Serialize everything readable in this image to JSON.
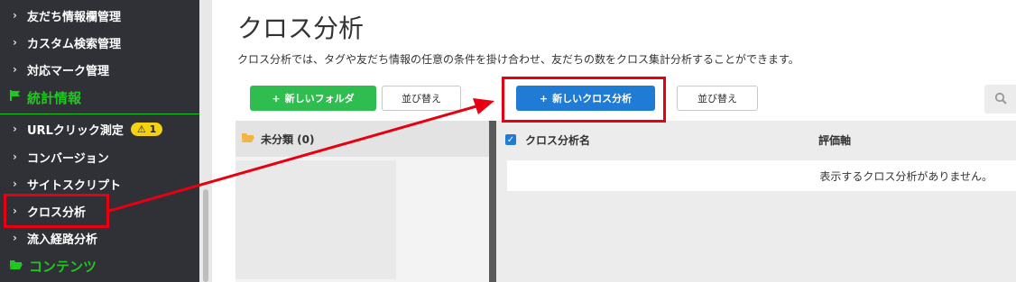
{
  "sidebar": {
    "items_top": [
      {
        "label": "友だち情報欄管理"
      },
      {
        "label": "カスタム検索管理"
      },
      {
        "label": "対応マーク管理"
      }
    ],
    "section_stats": {
      "label": "統計情報"
    },
    "items_stats": [
      {
        "label": "URLクリック測定",
        "badge": "1"
      },
      {
        "label": "コンバージョン"
      },
      {
        "label": "サイトスクリプト"
      },
      {
        "label": "クロス分析"
      },
      {
        "label": "流入経路分析"
      }
    ],
    "section_contents": {
      "label": "コンテンツ"
    }
  },
  "page": {
    "title": "クロス分析",
    "description": "クロス分析では、タグや友だち情報の任意の条件を掛け合わせ、友だちの数をクロス集計分析することができます。"
  },
  "toolbar": {
    "new_folder": "新しいフォルダ",
    "sort_left": "並び替え",
    "new_cross": "新しいクロス分析",
    "sort_right": "並び替え"
  },
  "folders": {
    "uncategorized": "未分類 (0)"
  },
  "table": {
    "col_name": "クロス分析名",
    "col_eval": "評価軸",
    "empty_message": "表示するクロス分析がありません。"
  },
  "colors": {
    "sidebar_bg": "#2f3137",
    "accent_green": "#1ec81e",
    "primary_blue": "#1f7bd4",
    "button_green": "#2fbd4f",
    "annotation_red": "#e60012"
  }
}
